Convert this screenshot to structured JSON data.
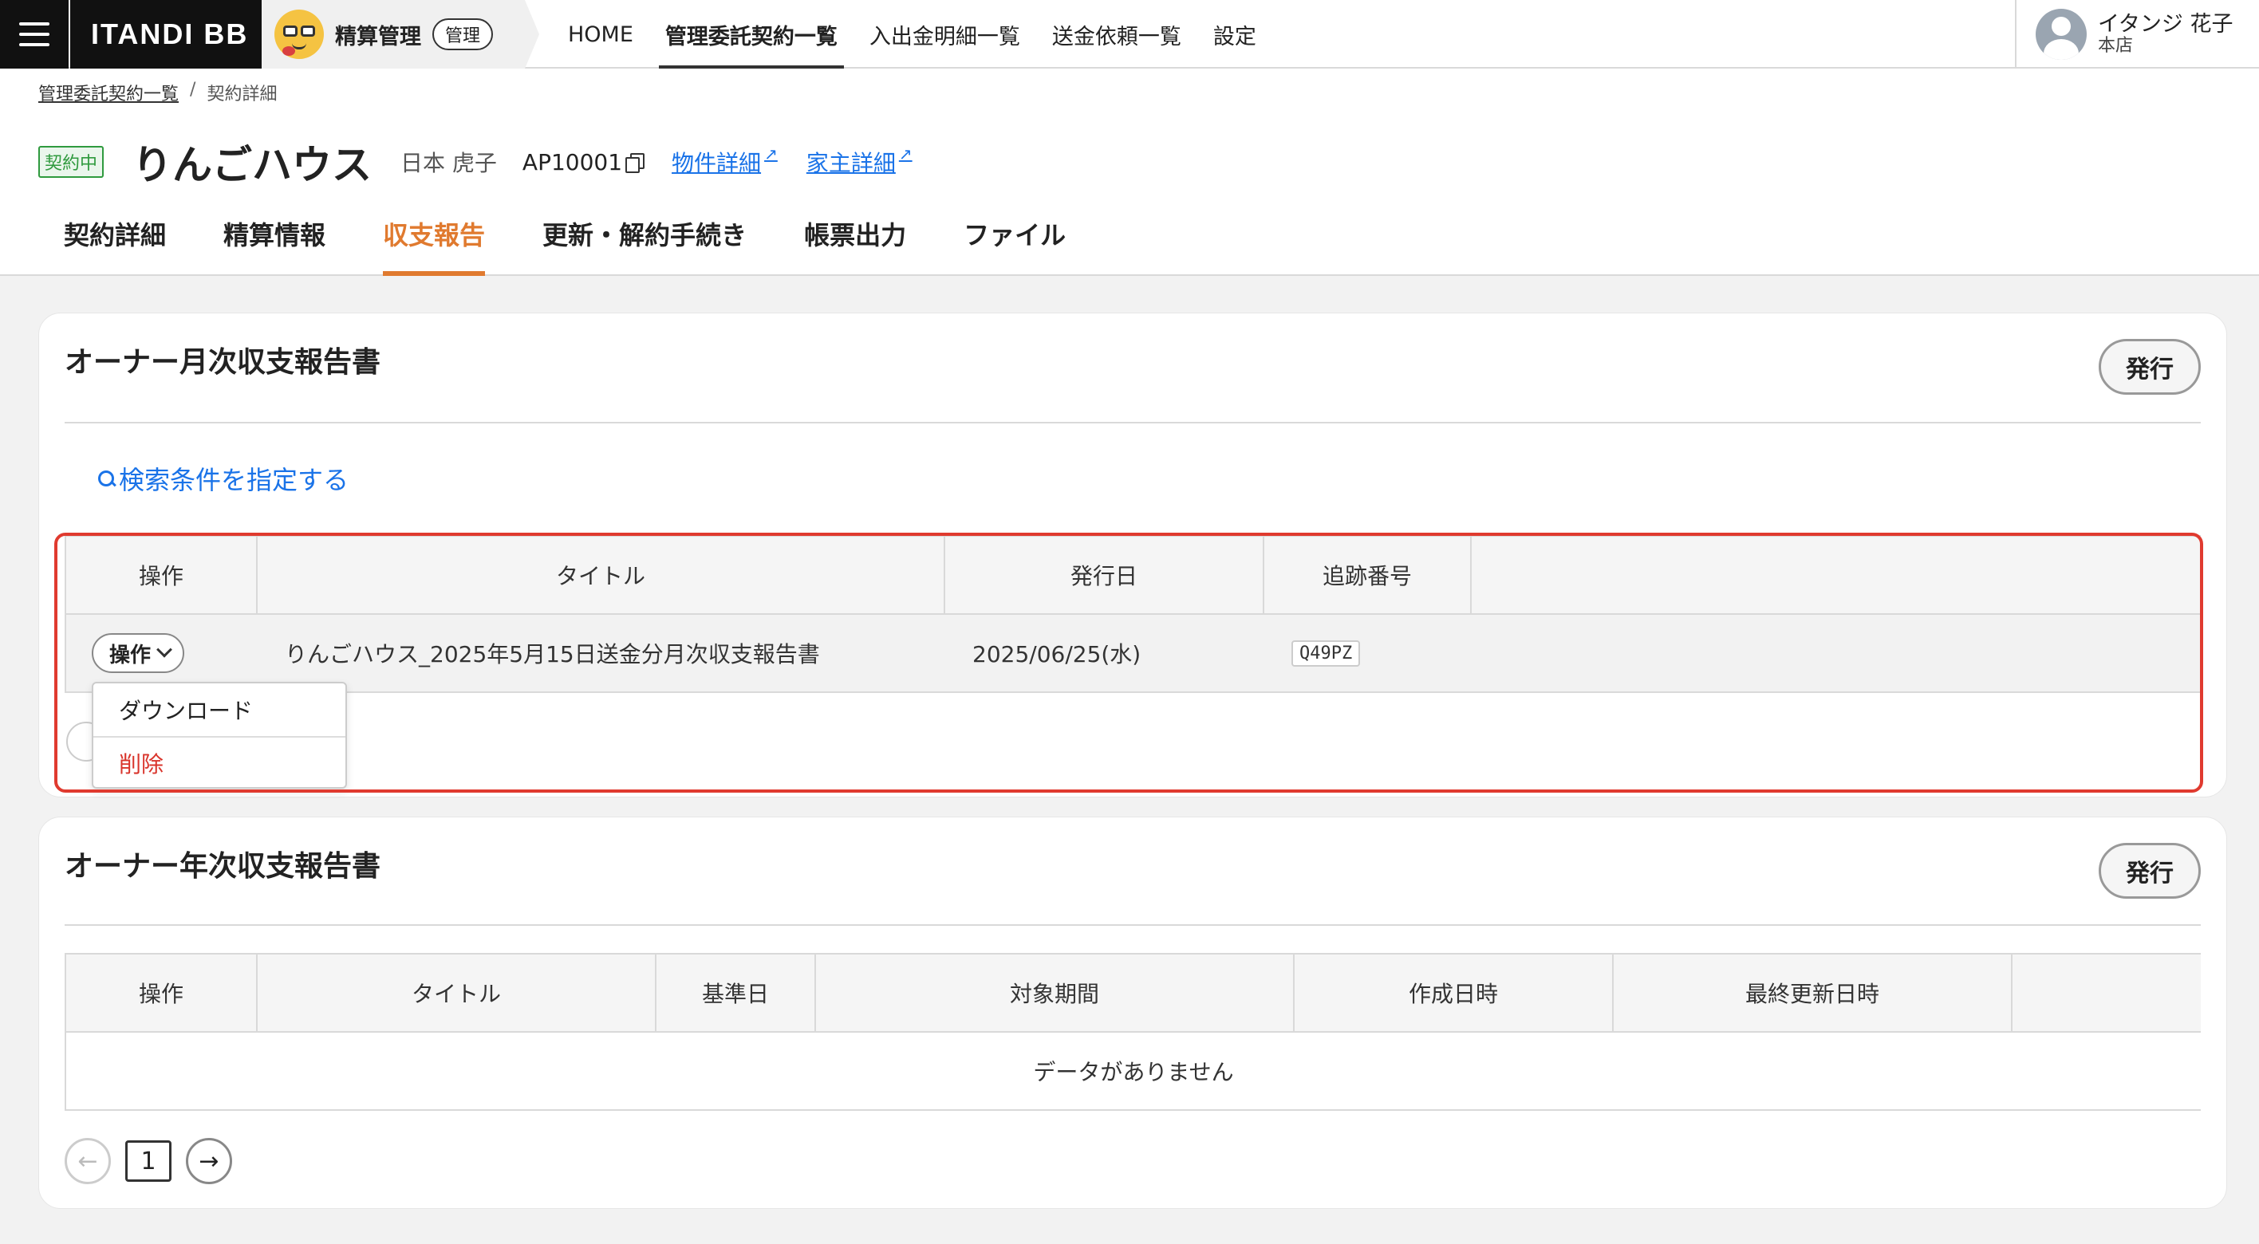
{
  "topnav": {
    "brand": "ITANDI BB",
    "app_name": "精算管理",
    "app_badge": "管理",
    "menu": [
      {
        "label": "HOME"
      },
      {
        "label": "管理委託契約一覧"
      },
      {
        "label": "入出金明細一覧"
      },
      {
        "label": "送金依頼一覧"
      },
      {
        "label": "設定"
      }
    ],
    "user": {
      "name": "イタンジ 花子",
      "branch": "本店"
    }
  },
  "breadcrumb": {
    "parent": "管理委託契約一覧",
    "separator": "/",
    "current": "契約詳細"
  },
  "contract": {
    "status": "契約中",
    "property_name": "りんごハウス",
    "owner_name": "日本 虎子",
    "contract_id": "AP10001",
    "property_link": "物件詳細",
    "owner_link": "家主詳細"
  },
  "tabs": [
    {
      "label": "契約詳細"
    },
    {
      "label": "精算情報"
    },
    {
      "label": "収支報告"
    },
    {
      "label": "更新・解約手続き"
    },
    {
      "label": "帳票出力"
    },
    {
      "label": "ファイル"
    }
  ],
  "monthly": {
    "title": "オーナー月次収支報告書",
    "issue_label": "発行",
    "search_label": "検索条件を指定する",
    "columns": [
      "操作",
      "タイトル",
      "発行日",
      "追跡番号",
      ""
    ],
    "rows": [
      {
        "ops_label": "操作",
        "title": "りんごハウス_2025年5月15日送金分月次収支報告書",
        "issued": "2025/06/25(水)",
        "tracking": "Q49PZ"
      }
    ],
    "dropdown": [
      {
        "label": "ダウンロード"
      },
      {
        "label": "削除"
      }
    ]
  },
  "annual": {
    "title": "オーナー年次収支報告書",
    "issue_label": "発行",
    "columns": [
      "操作",
      "タイトル",
      "基準日",
      "対象期間",
      "作成日時",
      "最終更新日時",
      ""
    ],
    "empty_text": "データがありません",
    "page": "1"
  },
  "colors": {
    "accent": "#e07a2f",
    "link": "#1a73e8",
    "status_green": "#2f9a3e",
    "danger": "#d9342b",
    "highlight": "#e03a2f"
  }
}
